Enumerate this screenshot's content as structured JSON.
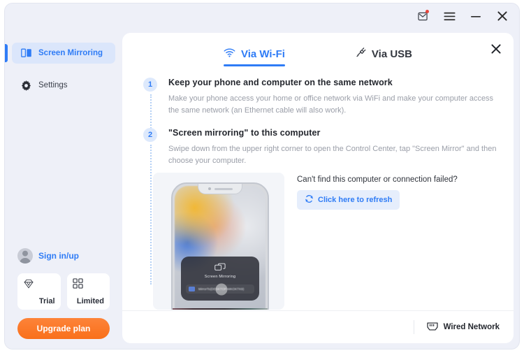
{
  "window": {
    "controls": [
      {
        "name": "mail-icon",
        "label": "Messages",
        "has_badge": true
      },
      {
        "name": "menu-icon",
        "label": "Menu"
      },
      {
        "name": "minimize-icon",
        "label": "Minimize"
      },
      {
        "name": "close-icon",
        "label": "Close"
      }
    ]
  },
  "sidebar": {
    "items": [
      {
        "label": "Screen Mirroring",
        "icon": "screen-mirroring-icon",
        "active": true
      },
      {
        "label": "Settings",
        "icon": "gear-icon",
        "active": false
      }
    ],
    "account": {
      "sign_in_label": "Sign in/up",
      "avatar_icon": "user-avatar-icon"
    },
    "plan_cards": [
      {
        "label": "Trial",
        "icon": "diamond-icon"
      },
      {
        "label": "Limited",
        "icon": "grid-icon"
      }
    ],
    "upgrade_label": "Upgrade plan"
  },
  "panel": {
    "close_label": "Close",
    "tabs": [
      {
        "label": "Via Wi-Fi",
        "icon": "wifi-icon",
        "active": true
      },
      {
        "label": "Via USB",
        "icon": "usb-icon",
        "active": false
      }
    ],
    "steps": [
      {
        "number": "1",
        "title": "Keep your phone and computer on the same network",
        "desc": "Make your phone access your home or office network via WiFi and make your computer access the same network (an Ethernet cable will also work)."
      },
      {
        "number": "2",
        "title": "\"Screen mirroring\" to this computer",
        "desc": "Swipe down from the upper right corner to open the Control Center, tap \"Screen Mirror\" and then choose your computer."
      }
    ],
    "phone_mock": {
      "control_center_title": "Screen Mirroring",
      "device_name": "MirrorTo(DESKTOP-MKOKTK9)",
      "mirror_icon": "screen-mirror-icon"
    },
    "help": {
      "question": "Can't find this computer or connection failed?",
      "refresh_label": "Click here to refresh",
      "refresh_icon": "refresh-icon"
    },
    "footer": {
      "wired_label": "Wired Network",
      "wired_icon": "ethernet-icon"
    }
  },
  "colors": {
    "accent_blue": "#2f7cf6",
    "upgrade_orange": "#f9701b",
    "window_bg": "#eef0f8",
    "panel_bg": "#ffffff",
    "badge_red": "#e8453c"
  }
}
